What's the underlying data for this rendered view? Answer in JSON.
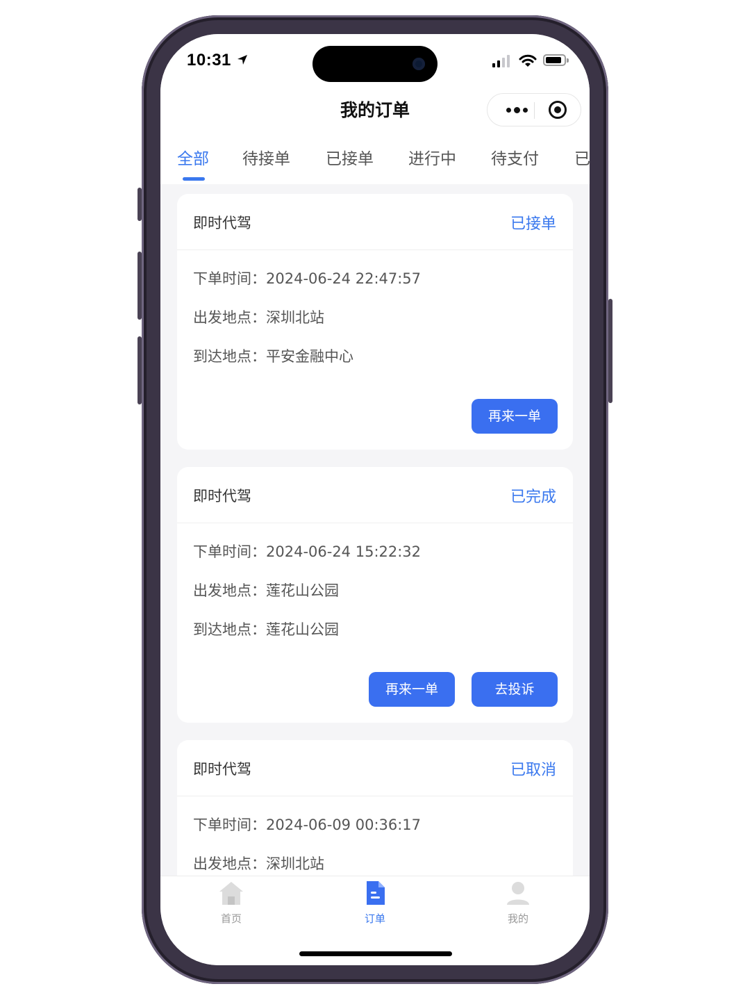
{
  "status_bar": {
    "time": "10:31"
  },
  "nav": {
    "title": "我的订单"
  },
  "tabs": [
    {
      "label": "全部",
      "active": true
    },
    {
      "label": "待接单",
      "active": false
    },
    {
      "label": "已接单",
      "active": false
    },
    {
      "label": "进行中",
      "active": false
    },
    {
      "label": "待支付",
      "active": false
    },
    {
      "label": "已",
      "active": false
    }
  ],
  "orders": [
    {
      "type": "即时代驾",
      "status": "已接单",
      "order_time_label": "下单时间：",
      "order_time": "2024-06-24 22:47:57",
      "from_label": "出发地点：",
      "from": "深圳北站",
      "to_label": "到达地点：",
      "to": "平安金融中心",
      "buttons": [
        "再来一单"
      ]
    },
    {
      "type": "即时代驾",
      "status": "已完成",
      "order_time_label": "下单时间：",
      "order_time": "2024-06-24 15:22:32",
      "from_label": "出发地点：",
      "from": "莲花山公园",
      "to_label": "到达地点：",
      "to": "莲花山公园",
      "buttons": [
        "再来一单",
        "去投诉"
      ]
    },
    {
      "type": "即时代驾",
      "status": "已取消",
      "order_time_label": "下单时间：",
      "order_time": "2024-06-09 00:36:17",
      "from_label": "出发地点：",
      "from": "深圳北站"
    }
  ],
  "tabbar": [
    {
      "label": "首页",
      "icon": "home-icon",
      "active": false
    },
    {
      "label": "订单",
      "icon": "order-document-icon",
      "active": true
    },
    {
      "label": "我的",
      "icon": "profile-icon",
      "active": false
    }
  ],
  "colors": {
    "accent": "#3a78ee",
    "button": "#3a6ff0",
    "background": "#f5f5f7"
  }
}
